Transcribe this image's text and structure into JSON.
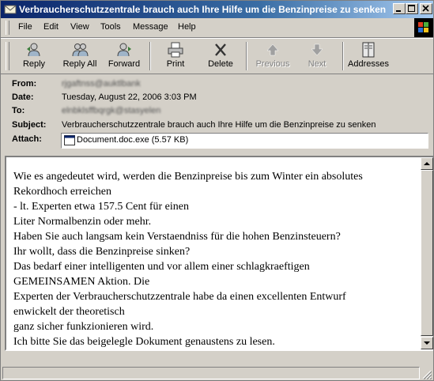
{
  "window": {
    "title": "Verbraucherschutzzentrale brauch auch Ihre Hilfe um die Benzinpreise zu senken"
  },
  "menu": [
    "File",
    "Edit",
    "View",
    "Tools",
    "Message",
    "Help"
  ],
  "toolbar": {
    "reply": "Reply",
    "reply_all": "Reply All",
    "forward": "Forward",
    "print": "Print",
    "delete": "Delete",
    "previous": "Previous",
    "next": "Next",
    "addresses": "Addresses"
  },
  "header": {
    "from_label": "From:",
    "from_value": "rjgaftnss@auktlbank",
    "date_label": "Date:",
    "date_value": "Tuesday, August 22, 2006 3:03 PM",
    "to_label": "To:",
    "to_value": "elnbklsffbqrgk@stasyelen",
    "subject_label": "Subject:",
    "subject_value": "Verbraucherschutzzentrale brauch auch Ihre Hilfe um die Benzinpreise zu senken",
    "attach_label": "Attach:",
    "attach_value": "Document.doc.exe (5.57 KB)"
  },
  "body": {
    "lines": [
      "Wie es angedeutet wird, werden die Benzinpreise bis zum Winter ein absolutes",
      "Rekordhoch erreichen",
      "- lt. Experten etwa 157.5 Cent für einen",
      "Liter Normalbenzin oder mehr.",
      "Haben Sie auch langsam kein Verstaendniss für die hohen Benzinsteuern?",
      "Ihr wollt, dass die Benzinpreise sinken?",
      "Das bedarf einer intelligenten und vor allem einer schlagkraeftigen",
      "GEMEINSAMEN Aktion. Die",
      "Experten der Verbraucherschutzzentrale habe da einen excellenten Entwurf",
      "enwickelt der theoretisch",
      "ganz sicher funkzionieren wird.",
      "Ich bitte Sie das beigelegle Dokument genaustens zu lesen."
    ]
  }
}
